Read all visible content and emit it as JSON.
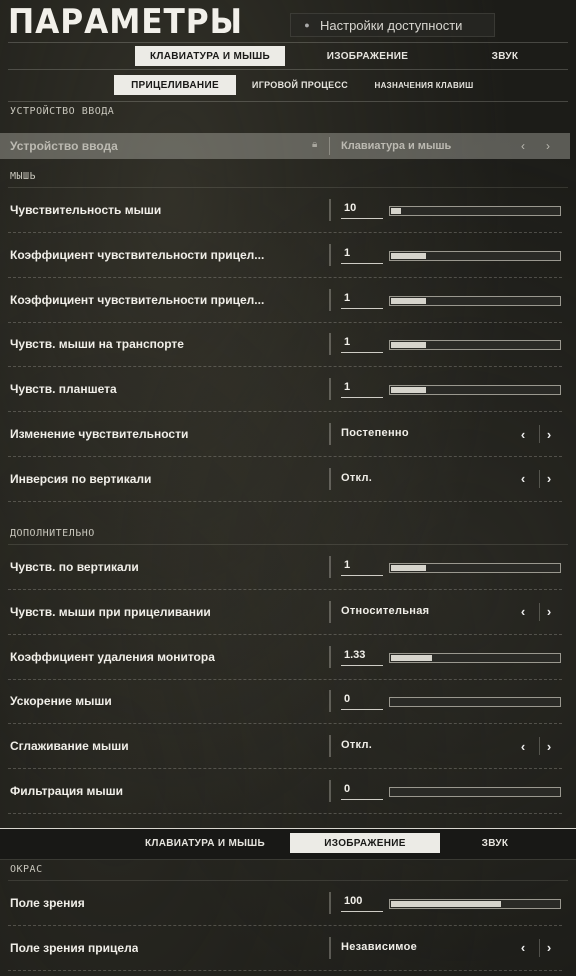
{
  "title": "ПАРАМЕТРЫ",
  "accessibility_label": "Настройки доступности",
  "main_tabs": [
    {
      "label": "КЛАВИАТУРА И МЫШЬ",
      "active": true
    },
    {
      "label": "ИЗОБРАЖЕНИЕ",
      "active": false
    },
    {
      "label": "ЗВУК",
      "active": false
    }
  ],
  "sub_tabs": [
    {
      "label": "ПРИЦЕЛИВАНИЕ",
      "active": true
    },
    {
      "label": "ИГРОВОЙ ПРОЦЕСС",
      "active": false
    },
    {
      "label": "НАЗНАЧЕНИЯ КЛАВИШ",
      "active": false
    }
  ],
  "sections": {
    "input_device": "УСТРОЙСТВО ВВОДА",
    "mouse": "МЫШЬ",
    "advanced": "ДОПОЛНИТЕЛЬНО",
    "color": "ОКРАС"
  },
  "device_row": {
    "label": "Устройство ввода",
    "value": "Клавиатура и мышь"
  },
  "mouse_rows": [
    {
      "label": "Чувствительность мыши",
      "type": "slider",
      "value": "10",
      "fill": 0.07
    },
    {
      "label": "Коэффициент чувствительности прицел...",
      "type": "slider",
      "value": "1",
      "fill": 0.22
    },
    {
      "label": "Коэффициент чувствительности прицел...",
      "type": "slider",
      "value": "1",
      "fill": 0.22
    },
    {
      "label": "Чувств. мыши на транспорте",
      "type": "slider",
      "value": "1",
      "fill": 0.22
    },
    {
      "label": "Чувств. планшета",
      "type": "slider",
      "value": "1",
      "fill": 0.22
    },
    {
      "label": "Изменение чувствительности",
      "type": "option",
      "value": "Постепенно"
    },
    {
      "label": "Инверсия по вертикали",
      "type": "option",
      "value": "Откл."
    }
  ],
  "advanced_rows": [
    {
      "label": "Чувств. по вертикали",
      "type": "slider",
      "value": "1",
      "fill": 0.22
    },
    {
      "label": "Чувств. мыши при прицеливании",
      "type": "option",
      "value": "Относительная"
    },
    {
      "label": "Коэффициент удаления монитора",
      "type": "slider",
      "value": "1.33",
      "fill": 0.25
    },
    {
      "label": "Ускорение мыши",
      "type": "slider",
      "value": "0",
      "fill": 0.0
    },
    {
      "label": "Сглаживание мыши",
      "type": "option",
      "value": "Откл."
    },
    {
      "label": "Фильтрация мыши",
      "type": "slider",
      "value": "0",
      "fill": 0.0
    }
  ],
  "bottom_tabs": [
    {
      "label": "КЛАВИАТУРА И МЫШЬ",
      "active": false
    },
    {
      "label": "ИЗОБРАЖЕНИЕ",
      "active": true
    },
    {
      "label": "ЗВУК",
      "active": false
    }
  ],
  "color_rows": [
    {
      "label": "Поле зрения",
      "type": "slider",
      "value": "100",
      "fill": 0.66
    },
    {
      "label": "Поле зрения прицела",
      "type": "option",
      "value": "Независимое"
    }
  ],
  "icons": {
    "accessibility": "gear-icon",
    "lock": "lock-icon",
    "prev": "chevron-left-icon",
    "next": "chevron-right-icon"
  }
}
